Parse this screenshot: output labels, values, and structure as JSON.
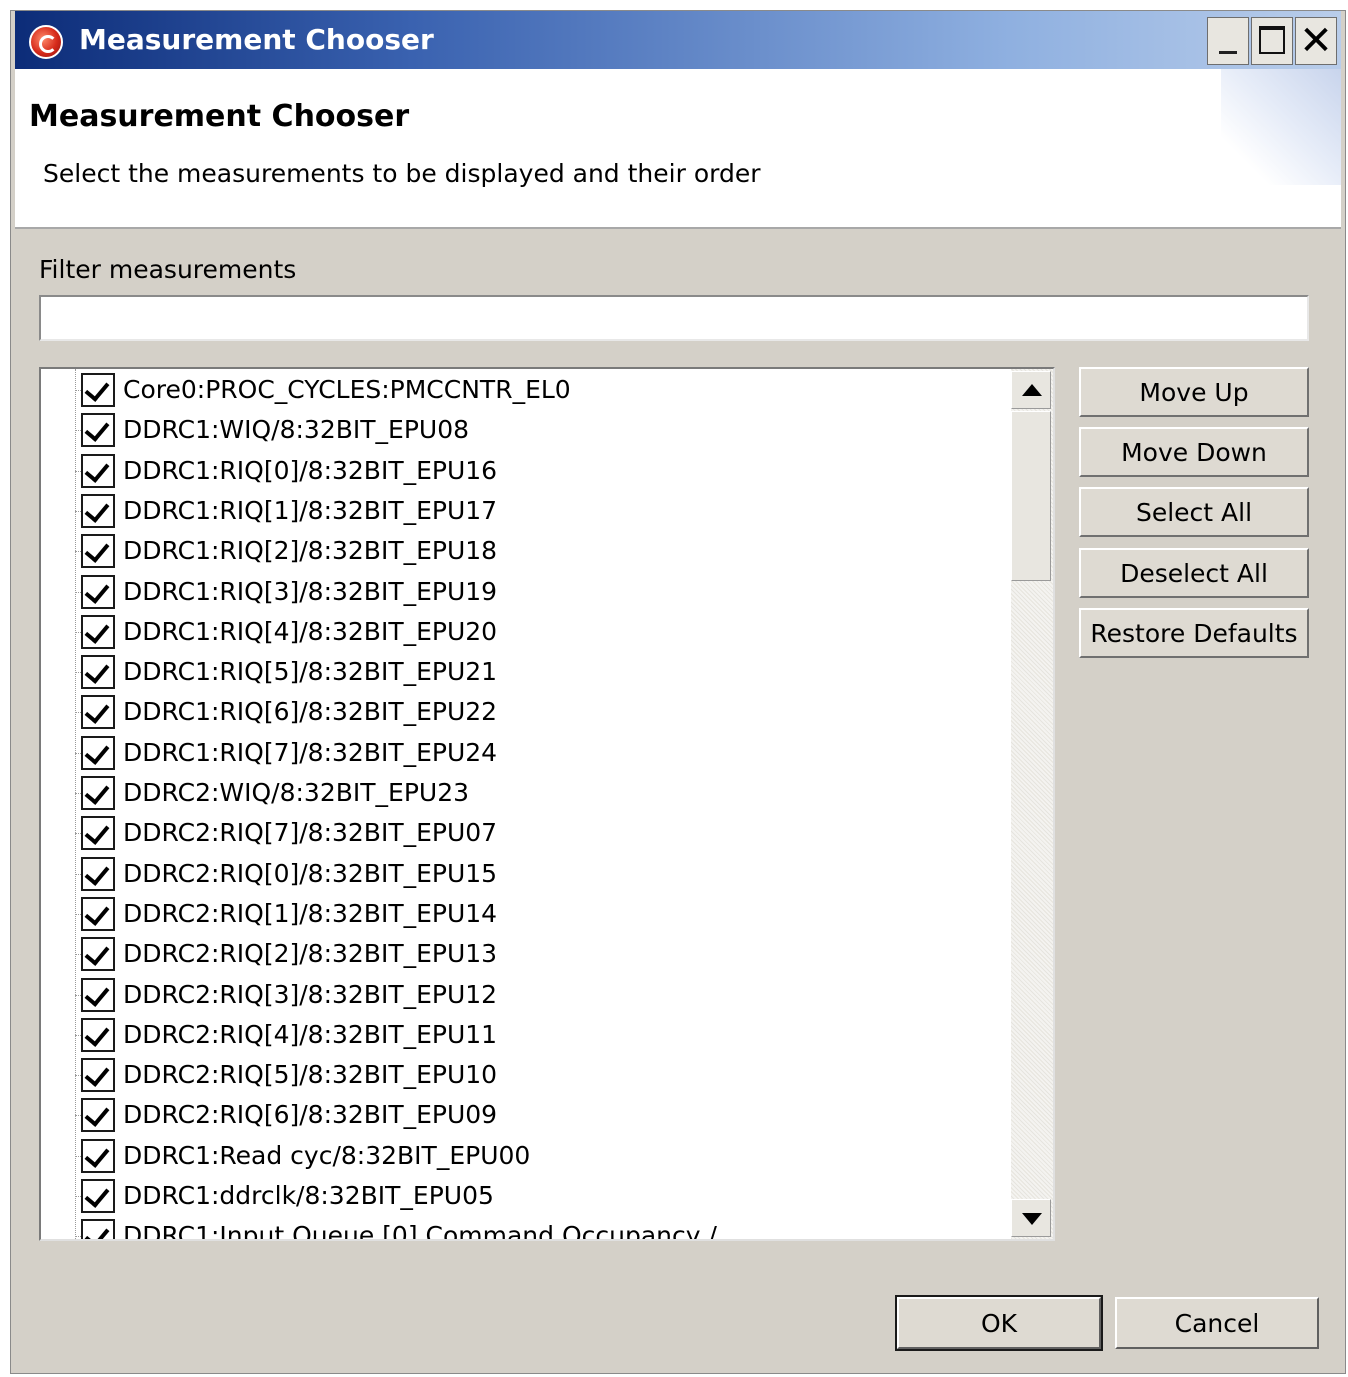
{
  "window": {
    "title": "Measurement Chooser",
    "icon": "app-logo-icon"
  },
  "header": {
    "title": "Measurement Chooser",
    "description": "Select the measurements to be displayed and their order"
  },
  "filter": {
    "label": "Filter measurements",
    "value": "",
    "placeholder": ""
  },
  "measurements": [
    {
      "label": "Core0:PROC_CYCLES:PMCCNTR_EL0",
      "checked": true
    },
    {
      "label": "DDRC1:WIQ/8:32BIT_EPU08",
      "checked": true
    },
    {
      "label": "DDRC1:RIQ[0]/8:32BIT_EPU16",
      "checked": true
    },
    {
      "label": "DDRC1:RIQ[1]/8:32BIT_EPU17",
      "checked": true
    },
    {
      "label": "DDRC1:RIQ[2]/8:32BIT_EPU18",
      "checked": true
    },
    {
      "label": "DDRC1:RIQ[3]/8:32BIT_EPU19",
      "checked": true
    },
    {
      "label": "DDRC1:RIQ[4]/8:32BIT_EPU20",
      "checked": true
    },
    {
      "label": "DDRC1:RIQ[5]/8:32BIT_EPU21",
      "checked": true
    },
    {
      "label": "DDRC1:RIQ[6]/8:32BIT_EPU22",
      "checked": true
    },
    {
      "label": "DDRC1:RIQ[7]/8:32BIT_EPU24",
      "checked": true
    },
    {
      "label": "DDRC2:WIQ/8:32BIT_EPU23",
      "checked": true
    },
    {
      "label": "DDRC2:RIQ[7]/8:32BIT_EPU07",
      "checked": true
    },
    {
      "label": "DDRC2:RIQ[0]/8:32BIT_EPU15",
      "checked": true
    },
    {
      "label": "DDRC2:RIQ[1]/8:32BIT_EPU14",
      "checked": true
    },
    {
      "label": "DDRC2:RIQ[2]/8:32BIT_EPU13",
      "checked": true
    },
    {
      "label": "DDRC2:RIQ[3]/8:32BIT_EPU12",
      "checked": true
    },
    {
      "label": "DDRC2:RIQ[4]/8:32BIT_EPU11",
      "checked": true
    },
    {
      "label": "DDRC2:RIQ[5]/8:32BIT_EPU10",
      "checked": true
    },
    {
      "label": "DDRC2:RIQ[6]/8:32BIT_EPU09",
      "checked": true
    },
    {
      "label": "DDRC1:Read cyc/8:32BIT_EPU00",
      "checked": true
    },
    {
      "label": "DDRC1:ddrclk/8:32BIT_EPU05",
      "checked": true
    },
    {
      "label": "DDRC1:Input Queue [0] Command Occupancy /",
      "checked": true
    }
  ],
  "side_buttons": {
    "move_up": "Move Up",
    "move_down": "Move Down",
    "select_all": "Select All",
    "deselect_all": "Deselect All",
    "restore_defaults": "Restore Defaults"
  },
  "footer": {
    "ok": "OK",
    "cancel": "Cancel"
  },
  "colors": {
    "title_bar_start": "#0c2c78",
    "title_bar_end": "#b9cdea",
    "dialog_background": "#d4d0c8"
  }
}
